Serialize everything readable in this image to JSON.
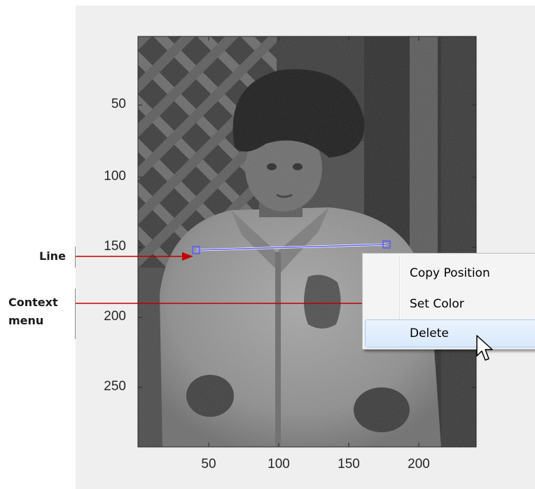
{
  "annotations": {
    "line_label": "Line",
    "context_menu_label_line1": "Context",
    "context_menu_label_line2": "menu",
    "arrow_color": "#c00000"
  },
  "axes": {
    "y_ticks": [
      "50",
      "100",
      "150",
      "200",
      "250"
    ],
    "x_ticks": [
      "50",
      "100",
      "150",
      "200"
    ]
  },
  "roi_line": {
    "color": "#5a5aff",
    "start": [
      42,
      153
    ],
    "end": [
      178,
      149
    ]
  },
  "context_menu": {
    "items": [
      {
        "label": "Copy Position",
        "has_submenu": false,
        "highlighted": false
      },
      {
        "label": "Set Color",
        "has_submenu": true,
        "highlighted": false
      },
      {
        "label": "Delete",
        "has_submenu": false,
        "highlighted": true
      }
    ],
    "submenu_arrow": "▶"
  },
  "icons": {
    "cursor": "arrow-cursor-icon",
    "line_handle": "square-handle-icon"
  }
}
